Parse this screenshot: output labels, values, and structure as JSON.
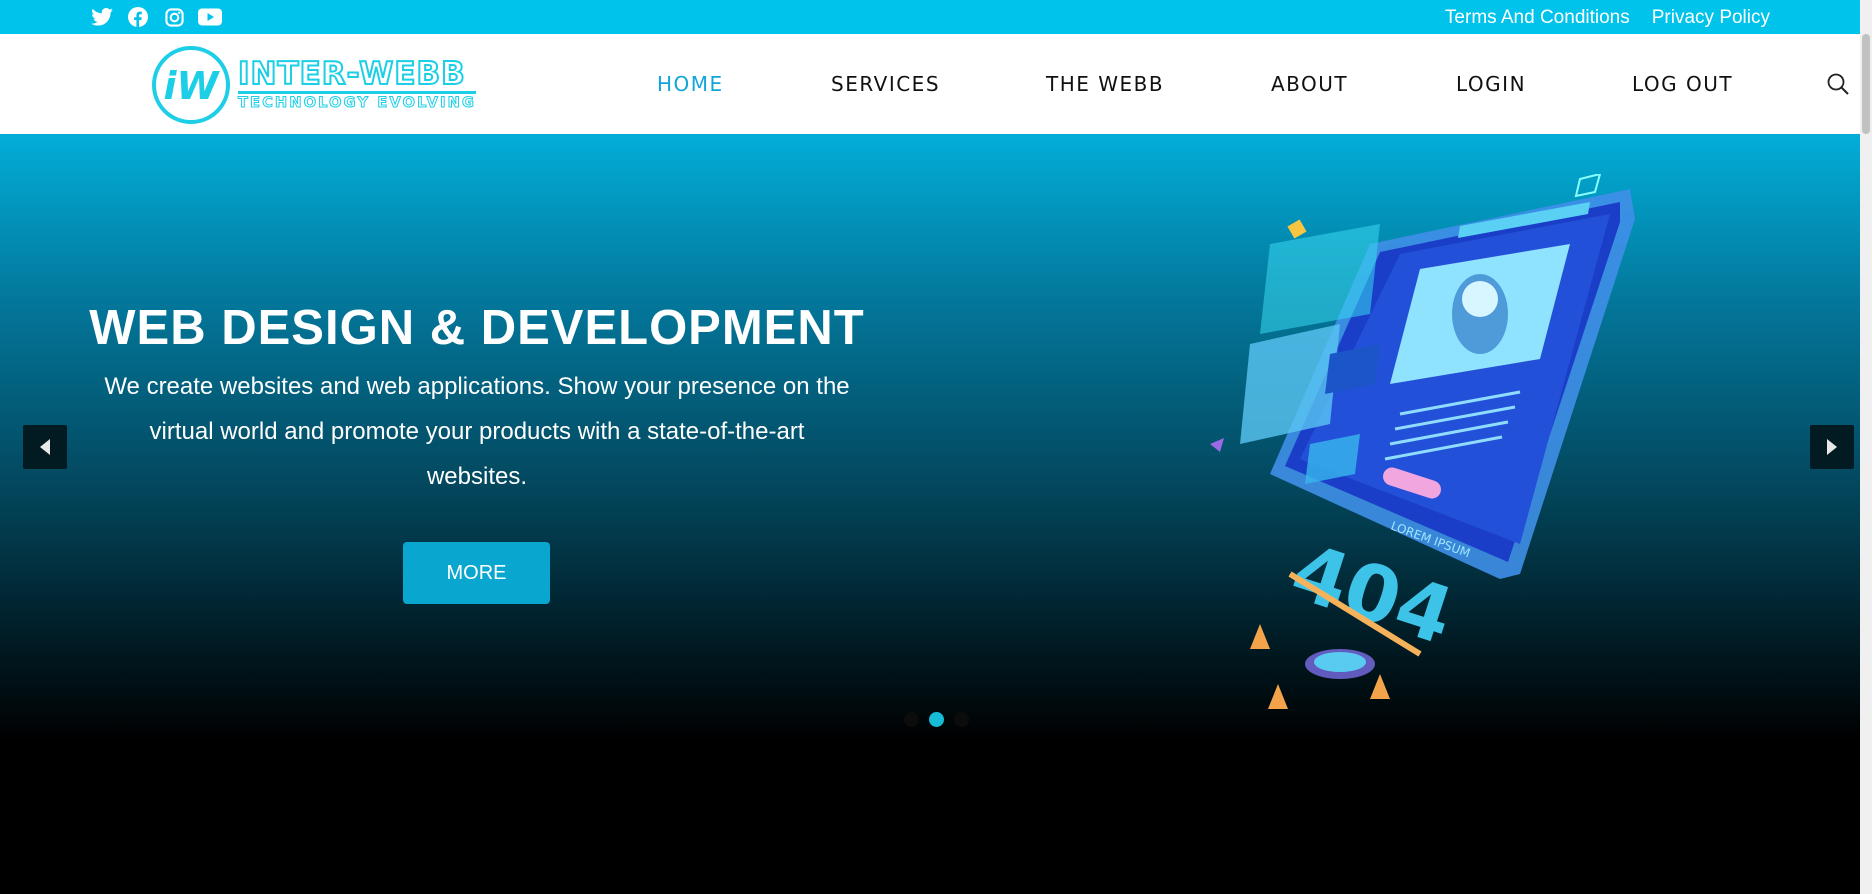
{
  "topbar": {
    "social_icons": [
      "twitter-icon",
      "facebook-icon",
      "instagram-icon",
      "youtube-icon"
    ],
    "links": [
      "Terms And Conditions",
      "Privacy Policy"
    ],
    "bg_color": "#00c3ec"
  },
  "header": {
    "logo": {
      "monogram": "iW",
      "main": "INTER-WEBB",
      "sub": "TECHNOLOGY EVOLVING"
    },
    "nav": [
      "HOME",
      "SERVICES",
      "THE WEBB",
      "ABOUT",
      "LOGIN",
      "LOG OUT"
    ],
    "active_nav": "HOME",
    "accent": "#11a5d8"
  },
  "hero": {
    "title": "WEB DESIGN & DEVELOPMENT",
    "text": "We create websites and web applications. Show your presence on the virtual world and promote your products with a state-of-the-art websites.",
    "button": "MORE",
    "illustration_label": "LOREM IPSUM",
    "illustration_number": "404",
    "slide_count": 3,
    "active_slide": 2
  }
}
